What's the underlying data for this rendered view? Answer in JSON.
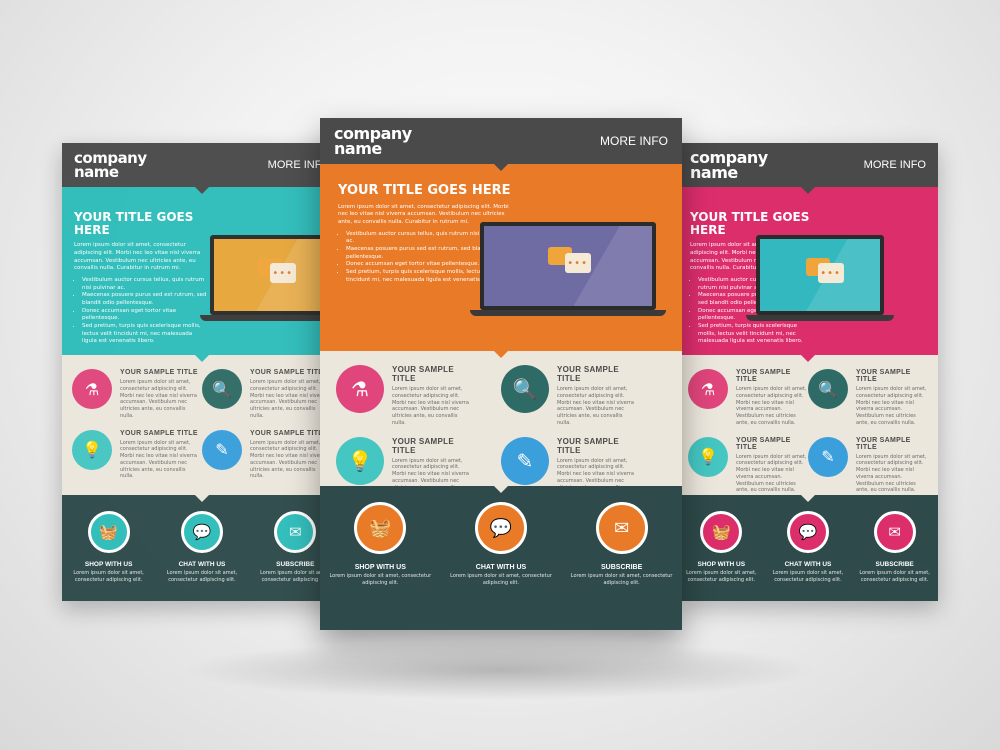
{
  "colors": {
    "header": "#4a4a4a",
    "teal": "#2ebdbb",
    "orange": "#e97a27",
    "pink": "#dd2e6c",
    "cream": "#ece7dd",
    "footer": "#2e4a4a"
  },
  "flyers": {
    "left": {
      "logo_line1": "company",
      "logo_line2": "name",
      "more_info": "MORE INFO",
      "title": "YOUR TITLE GOES HERE",
      "intro": "Lorem ipsum dolor sit amet, consectetur adipiscing elit. Morbi nec leo vitae nisl viverra accumsan. Vestibulum nec ultricies ante, eu convallis nulla. Curabitur in rutrum mi.",
      "bullets": [
        "Vestibulum auctor cursus tellus, quis rutrum nisi pulvinar ac.",
        "Maecenas posuere purus sed est rutrum, sed blandit odio pellentesque.",
        "Donec accumsan eget tortor vitae pellentesque.",
        "Sed pretium, turpis quis scelerisque mollis, lectus velit tincidunt mi, nec malesuada ligula est venenatis libero."
      ],
      "features": [
        {
          "title": "YOUR SAMPLE TITLE",
          "text": "Lorem ipsum dolor sit amet, consectetur adipiscing elit. Morbi nec leo vitae nisl viverra accumsan. Vestibulum nec ultricies ante, eu convallis nulla.",
          "icon": "flask-icon"
        },
        {
          "title": "YOUR SAMPLE TITLE",
          "text": "Lorem ipsum dolor sit amet, consectetur adipiscing elit. Morbi nec leo vitae nisl viverra accumsan. Vestibulum nec ultricies ante, eu convallis nulla.",
          "icon": "magnifier-icon"
        },
        {
          "title": "YOUR SAMPLE TITLE",
          "text": "Lorem ipsum dolor sit amet, consectetur adipiscing elit. Morbi nec leo vitae nisl viverra accumsan. Vestibulum nec ultricies ante, eu convallis nulla.",
          "icon": "lightbulb-icon"
        },
        {
          "title": "YOUR SAMPLE TITLE",
          "text": "Lorem ipsum dolor sit amet, consectetur adipiscing elit. Morbi nec leo vitae nisl viverra accumsan. Vestibulum nec ultricies ante, eu convallis nulla.",
          "icon": "pencil-icon"
        }
      ],
      "footer": [
        {
          "label": "SHOP WITH US",
          "text": "Lorem ipsum dolor sit amet, consectetur adipiscing elit.",
          "icon": "basket-icon"
        },
        {
          "label": "CHAT WITH US",
          "text": "Lorem ipsum dolor sit amet, consectetur adipiscing elit.",
          "icon": "chat-icon"
        },
        {
          "label": "SUBSCRIBE",
          "text": "Lorem ipsum dolor sit amet, consectetur adipiscing elit.",
          "icon": "envelope-icon"
        }
      ]
    },
    "center": {
      "logo_line1": "company",
      "logo_line2": "name",
      "more_info": "MORE INFO",
      "title": "YOUR TITLE GOES HERE",
      "intro": "Lorem ipsum dolor sit amet, consectetur adipiscing elit. Morbi nec leo vitae nisl viverra accumsan. Vestibulum nec ultricies ante, eu convallis nulla. Curabitur in rutrum mi.",
      "bullets": [
        "Vestibulum auctor cursus tellus, quis rutrum nisi pulvinar ac.",
        "Maecenas posuere purus sed est rutrum, sed blandit odio pellentesque.",
        "Donec accumsan eget tortor vitae pellentesque.",
        "Sed pretium, turpis quis scelerisque mollis, lectus velit tincidunt mi, nec malesuada ligula est venenatis libero."
      ],
      "features": [
        {
          "title": "YOUR SAMPLE TITLE",
          "text": "Lorem ipsum dolor sit amet, consectetur adipiscing elit. Morbi nec leo vitae nisl viverra accumsan. Vestibulum nec ultricies ante, eu convallis nulla.",
          "icon": "flask-icon"
        },
        {
          "title": "YOUR SAMPLE TITLE",
          "text": "Lorem ipsum dolor sit amet, consectetur adipiscing elit. Morbi nec leo vitae nisl viverra accumsan. Vestibulum nec ultricies ante, eu convallis nulla.",
          "icon": "magnifier-icon"
        },
        {
          "title": "YOUR SAMPLE TITLE",
          "text": "Lorem ipsum dolor sit amet, consectetur adipiscing elit. Morbi nec leo vitae nisl viverra accumsan. Vestibulum nec ultricies ante, eu convallis nulla.",
          "icon": "lightbulb-icon"
        },
        {
          "title": "YOUR SAMPLE TITLE",
          "text": "Lorem ipsum dolor sit amet, consectetur adipiscing elit. Morbi nec leo vitae nisl viverra accumsan. Vestibulum nec ultricies ante, eu convallis nulla.",
          "icon": "pencil-icon"
        }
      ],
      "footer": [
        {
          "label": "SHOP WITH US",
          "text": "Lorem ipsum dolor sit amet, consectetur adipiscing elit.",
          "icon": "basket-icon"
        },
        {
          "label": "CHAT WITH US",
          "text": "Lorem ipsum dolor sit amet, consectetur adipiscing elit.",
          "icon": "chat-icon"
        },
        {
          "label": "SUBSCRIBE",
          "text": "Lorem ipsum dolor sit amet, consectetur adipiscing elit.",
          "icon": "envelope-icon"
        }
      ]
    },
    "right": {
      "logo_line1": "company",
      "logo_line2": "name",
      "more_info": "MORE INFO",
      "title": "YOUR TITLE GOES HERE",
      "intro": "Lorem ipsum dolor sit amet, consectetur adipiscing elit. Morbi nec leo vitae nisl viverra accumsan. Vestibulum nec ultricies ante, eu convallis nulla. Curabitur in rutrum mi.",
      "bullets": [
        "Vestibulum auctor cursus tellus, quis rutrum nisi pulvinar ac.",
        "Maecenas posuere purus sed est rutrum, sed blandit odio pellentesque.",
        "Donec accumsan eget tortor vitae pellentesque.",
        "Sed pretium, turpis quis scelerisque mollis, lectus velit tincidunt mi, nec malesuada ligula est venenatis libero."
      ],
      "features": [
        {
          "title": "YOUR SAMPLE TITLE",
          "text": "Lorem ipsum dolor sit amet, consectetur adipiscing elit. Morbi nec leo vitae nisl viverra accumsan. Vestibulum nec ultricies ante, eu convallis nulla.",
          "icon": "flask-icon"
        },
        {
          "title": "YOUR SAMPLE TITLE",
          "text": "Lorem ipsum dolor sit amet, consectetur adipiscing elit. Morbi nec leo vitae nisl viverra accumsan. Vestibulum nec ultricies ante, eu convallis nulla.",
          "icon": "magnifier-icon"
        },
        {
          "title": "YOUR SAMPLE TITLE",
          "text": "Lorem ipsum dolor sit amet, consectetur adipiscing elit. Morbi nec leo vitae nisl viverra accumsan. Vestibulum nec ultricies ante, eu convallis nulla.",
          "icon": "lightbulb-icon"
        },
        {
          "title": "YOUR SAMPLE TITLE",
          "text": "Lorem ipsum dolor sit amet, consectetur adipiscing elit. Morbi nec leo vitae nisl viverra accumsan. Vestibulum nec ultricies ante, eu convallis nulla.",
          "icon": "pencil-icon"
        }
      ],
      "footer": [
        {
          "label": "SHOP WITH US",
          "text": "Lorem ipsum dolor sit amet, consectetur adipiscing elit.",
          "icon": "basket-icon"
        },
        {
          "label": "CHAT WITH US",
          "text": "Lorem ipsum dolor sit amet, consectetur adipiscing elit.",
          "icon": "chat-icon"
        },
        {
          "label": "SUBSCRIBE",
          "text": "Lorem ipsum dolor sit amet, consectetur adipiscing elit.",
          "icon": "envelope-icon"
        }
      ]
    }
  }
}
